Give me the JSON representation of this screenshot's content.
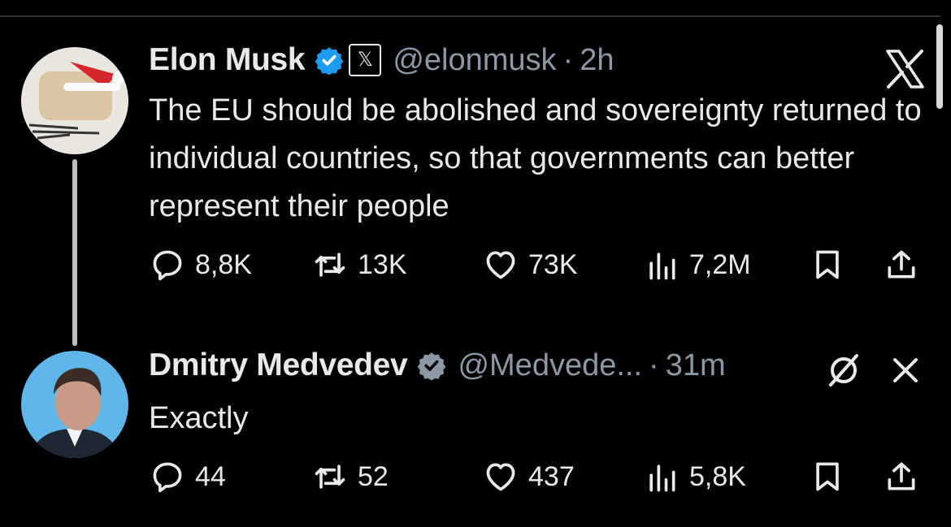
{
  "tweets": [
    {
      "author_name": "Elon Musk",
      "handle": "@elonmusk",
      "separator": "·",
      "time": "2h",
      "affiliate_badge": "𝕏",
      "text": "The EU should be abolished and sovereignty returned to individual countries, so that governments can better represent their people",
      "replies": "8,8K",
      "reposts": "13K",
      "likes": "73K",
      "views": "7,2M"
    },
    {
      "author_name": "Dmitry Medvedev",
      "handle": "@Medvede...",
      "separator": "·",
      "time": "31m",
      "text": "Exactly",
      "replies": "44",
      "reposts": "52",
      "likes": "437",
      "views": "5,8K"
    }
  ],
  "icons": {
    "verified": "verified-badge-icon",
    "x_logo": "x-logo-icon",
    "reply": "reply-icon",
    "repost": "repost-icon",
    "like": "heart-icon",
    "views": "views-icon",
    "bookmark": "bookmark-icon",
    "share": "share-icon",
    "muted": "slash-circle-icon",
    "close": "close-icon"
  },
  "colors": {
    "background": "#000000",
    "text": "#e7e9ea",
    "secondary": "#8b98a5",
    "verified": "#1d9bf0"
  }
}
